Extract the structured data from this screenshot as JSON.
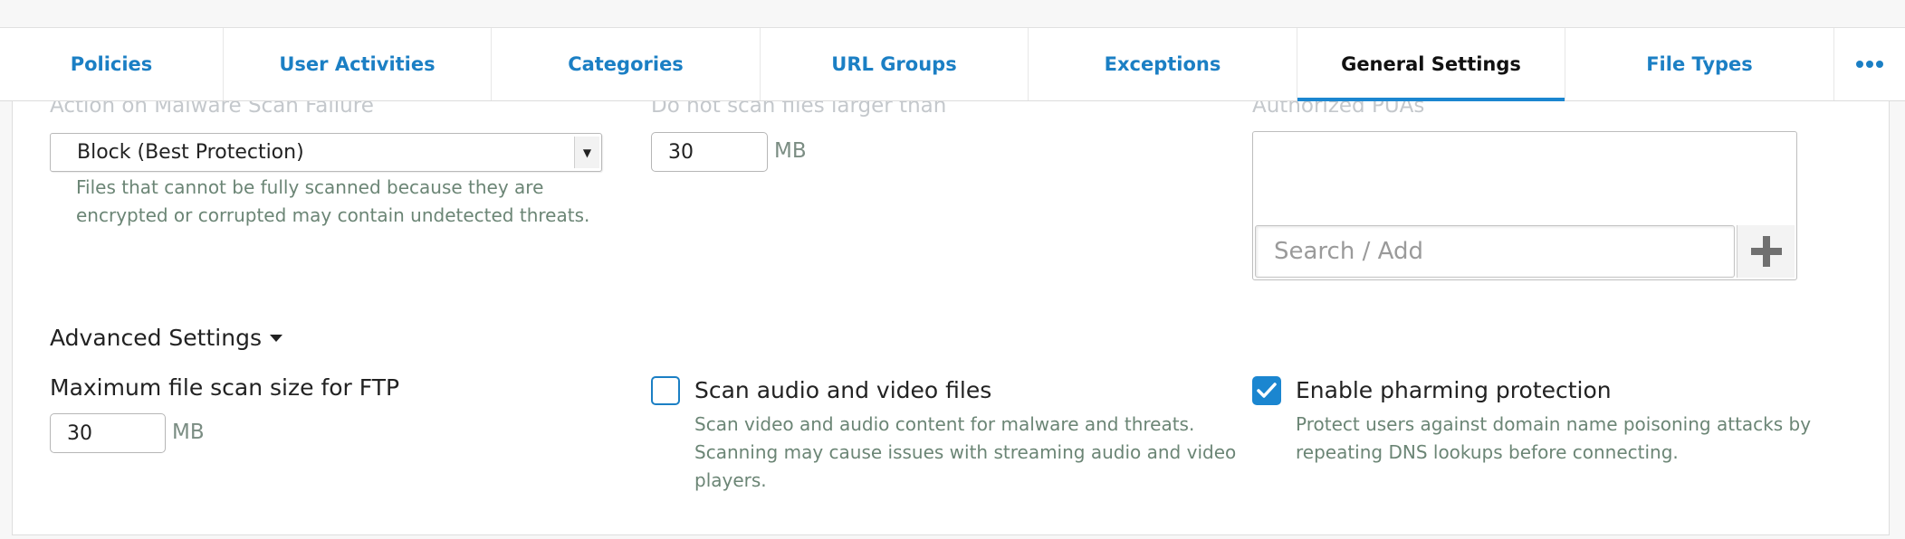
{
  "tabs": [
    {
      "label": "Policies",
      "active": false
    },
    {
      "label": "User Activities",
      "active": false
    },
    {
      "label": "Categories",
      "active": false
    },
    {
      "label": "URL Groups",
      "active": false
    },
    {
      "label": "Exceptions",
      "active": false
    },
    {
      "label": "General Settings",
      "active": true
    },
    {
      "label": "File Types",
      "active": false
    }
  ],
  "tabs_more_icon": "ellipsis-icon",
  "malware_failure": {
    "label": "Action on Malware Scan Failure",
    "selected": "Block (Best Protection)",
    "help": "Files that cannot be fully scanned because they are encrypted or corrupted may contain undetected threats."
  },
  "max_scan": {
    "label": "Do not scan files larger than",
    "value": "30",
    "unit": "MB"
  },
  "authorized_puas": {
    "label": "Authorized PUAs",
    "search_placeholder": "Search / Add",
    "add_icon": "plus-icon"
  },
  "advanced": {
    "toggle_label": "Advanced Settings",
    "ftp_label": "Maximum file scan size for FTP",
    "ftp_value": "30",
    "ftp_unit": "MB",
    "scan_av": {
      "label": "Scan audio and video files",
      "checked": false,
      "help": "Scan video and audio content for malware and threats. Scanning may cause issues with streaming audio and video players."
    },
    "pharming": {
      "label": "Enable pharming protection",
      "checked": true,
      "help": "Protect users against domain name poisoning attacks by repeating DNS lookups before connecting."
    }
  },
  "colors": {
    "accent": "#1b86d0",
    "link": "#1b7fc4",
    "help_text": "#6b8575"
  }
}
